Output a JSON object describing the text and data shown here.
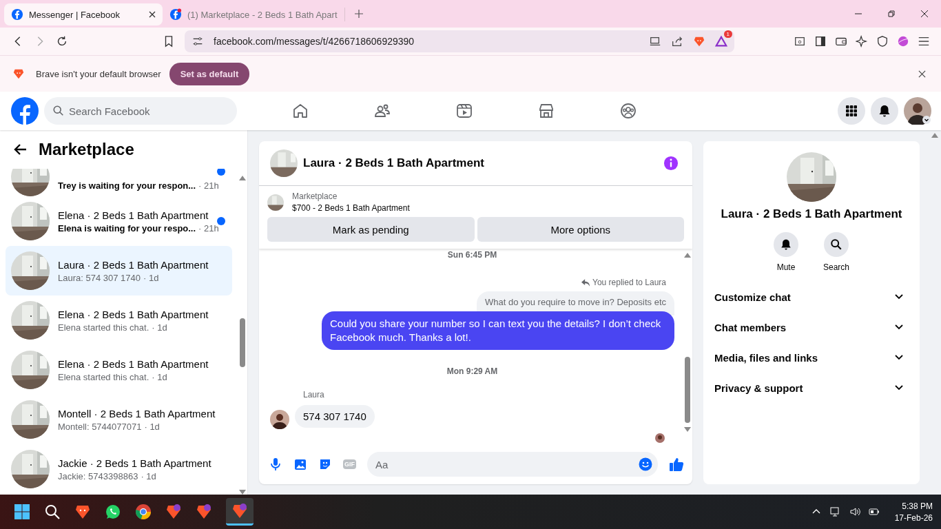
{
  "browser": {
    "tabs": [
      {
        "title": "Messenger | Facebook",
        "selected": true,
        "notification": false
      },
      {
        "title": "(1) Marketplace - 2 Beds 1 Bath Apart",
        "selected": false,
        "notification": true
      }
    ],
    "address": "facebook.com/messages/t/4266718606929390",
    "rewards_badge": "1",
    "infobar": {
      "message": "Brave isn't your default browser",
      "button": "Set as default"
    }
  },
  "header": {
    "search_placeholder": "Search Facebook"
  },
  "sidebar": {
    "title": "Marketplace",
    "conversations": [
      {
        "preview": "Trey is waiting for your respon...",
        "time": "· 21h",
        "unread": true,
        "selected": false
      },
      {
        "title": "Elena · 2 Beds 1 Bath Apartment",
        "preview": "Elena is waiting for your respo...",
        "time": "· 21h",
        "unread": true,
        "selected": false
      },
      {
        "title": "Laura · 2 Beds 1 Bath Apartment",
        "preview": "Laura: 574 307 1740",
        "time": "· 1d",
        "unread": false,
        "selected": true
      },
      {
        "title": "Elena · 2 Beds 1 Bath Apartment",
        "preview": "Elena started this chat.",
        "time": "· 1d",
        "unread": false,
        "selected": false
      },
      {
        "title": "Elena · 2 Beds 1 Bath Apartment",
        "preview": "Elena started this chat.",
        "time": "· 1d",
        "unread": false,
        "selected": false
      },
      {
        "title": "Montell · 2 Beds 1 Bath Apartment",
        "preview": "Montell: 5744077071",
        "time": "· 1d",
        "unread": false,
        "selected": false
      },
      {
        "title": "Jackie · 2 Beds 1 Bath Apartment",
        "preview": "Jackie: 5743398863",
        "time": "· 1d",
        "unread": false,
        "selected": false
      }
    ]
  },
  "chat": {
    "title": "Laura · 2 Beds 1 Bath Apartment",
    "listing": {
      "source": "Marketplace",
      "item": "$700 - 2 Beds 1 Bath Apartment"
    },
    "buttons": [
      "Mark as pending",
      "More options"
    ],
    "messages": [
      {
        "kind": "timestamp",
        "text": "Sun 6:45 PM"
      },
      {
        "kind": "reply_note",
        "text": "You replied to Laura"
      },
      {
        "kind": "quoted",
        "text": "What do you require to move in? Deposits etc"
      },
      {
        "kind": "outgoing",
        "text": "Could you share your number so I can text you the details? I don’t check Facebook much. Thanks a lot!."
      },
      {
        "kind": "timestamp",
        "text": "Mon 9:29 AM"
      },
      {
        "kind": "incoming",
        "sender": "Laura",
        "text": "574 307 1740"
      }
    ],
    "composer": {
      "gif_label": "GIF",
      "placeholder": "Aa"
    }
  },
  "details": {
    "title": "Laura · 2 Beds 1 Bath Apartment",
    "actions": [
      "Mute",
      "Search"
    ],
    "sections": [
      "Customize chat",
      "Chat members",
      "Media, files and links",
      "Privacy & support"
    ]
  },
  "taskbar": {
    "time": "5:38 PM",
    "date": "17-Feb-26"
  }
}
